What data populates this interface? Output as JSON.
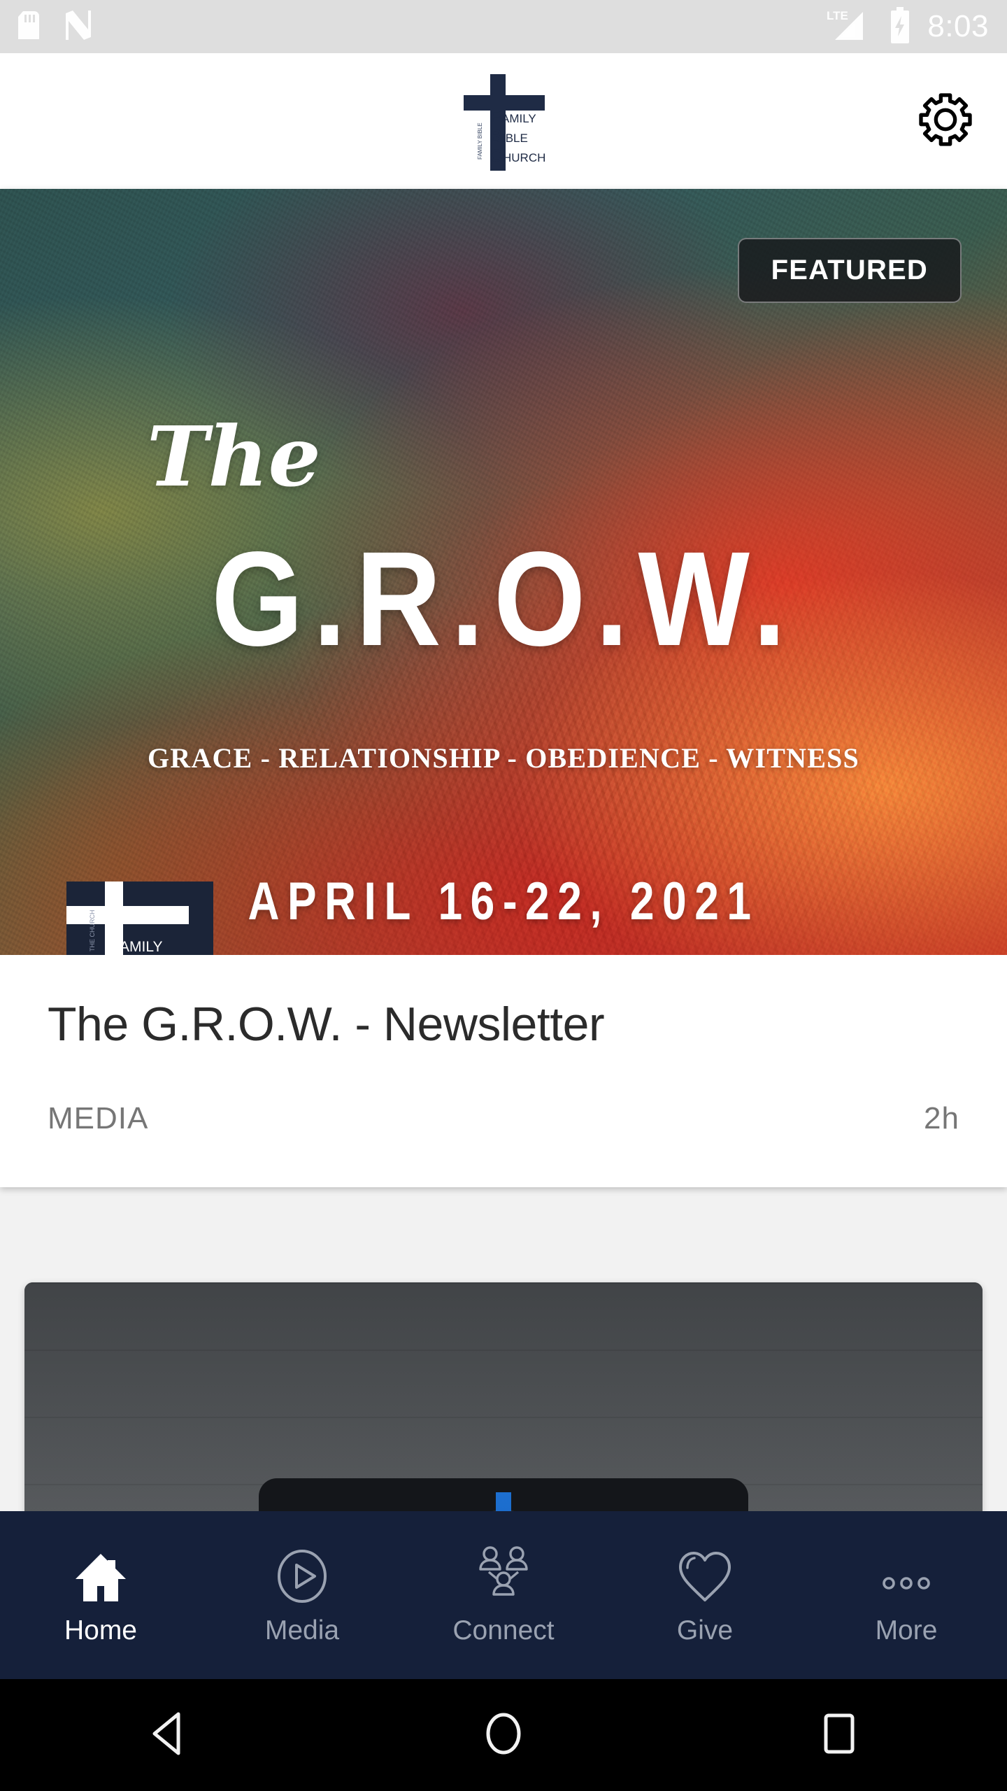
{
  "status_bar": {
    "time": "8:03",
    "network_label": "LTE",
    "icons": [
      "sd-card-icon",
      "nfc-icon",
      "lte-signal-icon",
      "battery-charging-icon"
    ],
    "background_color": "#dedede",
    "foreground_color": "#ffffff"
  },
  "app_header": {
    "logo_name": "family-bible-church-logo",
    "logo_lines": [
      "FAMILY",
      "BIBLE",
      "CHURCH"
    ],
    "logo_initials": [
      "F",
      "B",
      "C"
    ],
    "settings_label": "Settings",
    "background_color": "#ffffff"
  },
  "feed": {
    "featured_card": {
      "badge_label": "FEATURED",
      "hero": {
        "script_word": "The",
        "acronym": "G.R.O.W.",
        "tagline": "GRACE - RELATIONSHIP - OBEDIENCE - WITNESS",
        "date_range": "APRIL 16-22, 2021",
        "corner_logo_text": "FAMILY"
      },
      "title": "The G.R.O.W. - Newsletter",
      "category": "MEDIA",
      "timestamp": "2h"
    },
    "second_card": {
      "image_name": "open-bible-photo"
    },
    "page_background_color": "#f2f2f2",
    "card_background_color": "#ffffff"
  },
  "tab_bar": {
    "background_color": "#15203a",
    "active_color": "#ffffff",
    "inactive_color": "#9aa2b1",
    "items": [
      {
        "label": "Home",
        "icon": "home-icon",
        "active": true
      },
      {
        "label": "Media",
        "icon": "play-circle-icon",
        "active": false
      },
      {
        "label": "Connect",
        "icon": "people-group-icon",
        "active": false
      },
      {
        "label": "Give",
        "icon": "heart-icon",
        "active": false
      },
      {
        "label": "More",
        "icon": "ellipsis-icon",
        "active": false
      }
    ]
  },
  "system_nav": {
    "background_color": "#000000",
    "items": [
      {
        "label": "Back",
        "icon": "back-triangle-icon"
      },
      {
        "label": "Home",
        "icon": "home-circle-icon"
      },
      {
        "label": "Recents",
        "icon": "recents-square-icon"
      }
    ]
  }
}
